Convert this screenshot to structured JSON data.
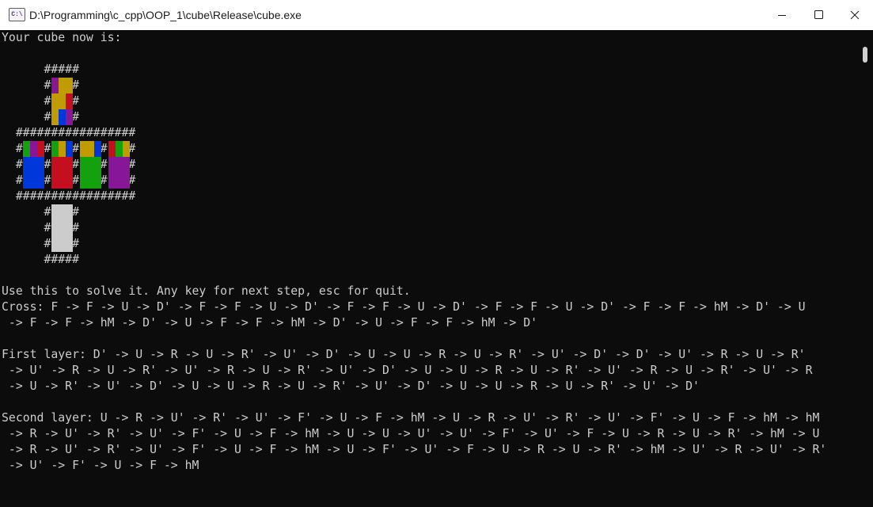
{
  "window": {
    "title": "D:\\Programming\\c_cpp\\OOP_1\\cube\\Release\\cube.exe",
    "icon": "console-app-icon",
    "icon_text": "C:\\"
  },
  "console": {
    "header": "Your cube now is:",
    "hash_art": [
      "      #####",
      "      #   #",
      "      #   #",
      "      #   #",
      "  #################",
      "  #   #   #   #   #",
      "  #   #   #   #   #",
      "  #   #   #   #   #",
      "  #################",
      "      #   #",
      "      #   #",
      "      #   #",
      "      #####"
    ],
    "palette": {
      "Y": "#c19c00",
      "P": "#881798",
      "R": "#c50f1f",
      "G": "#13a10e",
      "B": "#0037da",
      "W": "#cccccc"
    },
    "faces": {
      "top": [
        "PYY",
        "YYR",
        "YBP"
      ],
      "left": [
        "GPR",
        "BBB",
        "BBB"
      ],
      "front": [
        "GYB",
        "RRR",
        "RRR"
      ],
      "right": [
        "YYB",
        "GGG",
        "GGG"
      ],
      "back": [
        "RGY",
        "PPP",
        "PPP"
      ],
      "bottom": [
        "WWW",
        "WWW",
        "WWW"
      ]
    },
    "output_lines": [
      "",
      "Use this to solve it. Any key for next step, esc for quit.",
      "Cross: F -> F -> U -> D' -> F -> F -> U -> D' -> F -> F -> U -> D' -> F -> F -> U -> D' -> F -> F -> hM -> D' -> U",
      " -> F -> F -> hM -> D' -> U -> F -> F -> hM -> D' -> U -> F -> F -> hM -> D'",
      "",
      "First layer: D' -> U -> R -> U -> R' -> U' -> D' -> U -> U -> R -> U -> R' -> U' -> D' -> D' -> U' -> R -> U -> R'",
      " -> U' -> R -> U -> R' -> U' -> R -> U -> R' -> U' -> D' -> U -> U -> R -> U -> R' -> U' -> R -> U -> R' -> U' -> R",
      " -> U -> R' -> U' -> D' -> U -> U -> R -> U -> R' -> U' -> D' -> U -> U -> R -> U -> R' -> U' -> D'",
      "",
      "Second layer: U -> R -> U' -> R' -> U' -> F' -> U -> F -> hM -> U -> R -> U' -> R' -> U' -> F' -> U -> F -> hM -> hM",
      " -> R -> U' -> R' -> U' -> F' -> U -> F -> hM -> U -> U -> U' -> U' -> F' -> U' -> F -> U -> R -> U -> R' -> hM -> U",
      " -> R -> U' -> R' -> U' -> F' -> U -> F -> hM -> U -> F' -> U' -> F -> U -> R -> U -> R' -> hM -> U' -> R -> U' -> R'",
      " -> U' -> F' -> U -> F -> hM"
    ]
  }
}
